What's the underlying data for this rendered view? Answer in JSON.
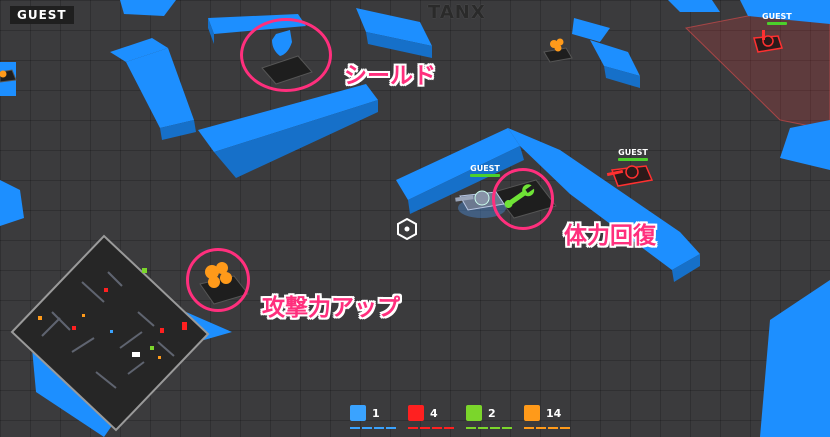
{
  "hud": {
    "player_name": "GUEST",
    "logo": "TANX"
  },
  "annotations": {
    "shield": "シールド",
    "heal": "体力回復",
    "attack_up": "攻撃力アップ"
  },
  "tanks": [
    {
      "name": "GUEST",
      "team_color": "#3aa3ff"
    },
    {
      "name": "GUEST",
      "team_color": "#ff2020"
    },
    {
      "name": "GUEST",
      "team_color": "#ff2020"
    }
  ],
  "scores": [
    {
      "team": "blue",
      "color": "#3aa3ff",
      "value": "1"
    },
    {
      "team": "red",
      "color": "#ff2020",
      "value": "4"
    },
    {
      "team": "green",
      "color": "#7bd62b",
      "value": "2"
    },
    {
      "team": "orange",
      "color": "#ff9a1a",
      "value": "14"
    }
  ],
  "colors": {
    "wall": "#1d8fff",
    "annotation": "#ff2f7d",
    "floor": "#3b3b3d"
  },
  "icons": {
    "shield": "shield-icon",
    "heal": "wrench-icon",
    "attack_up": "explosion-icon",
    "hex": "hexagon-target-icon"
  }
}
